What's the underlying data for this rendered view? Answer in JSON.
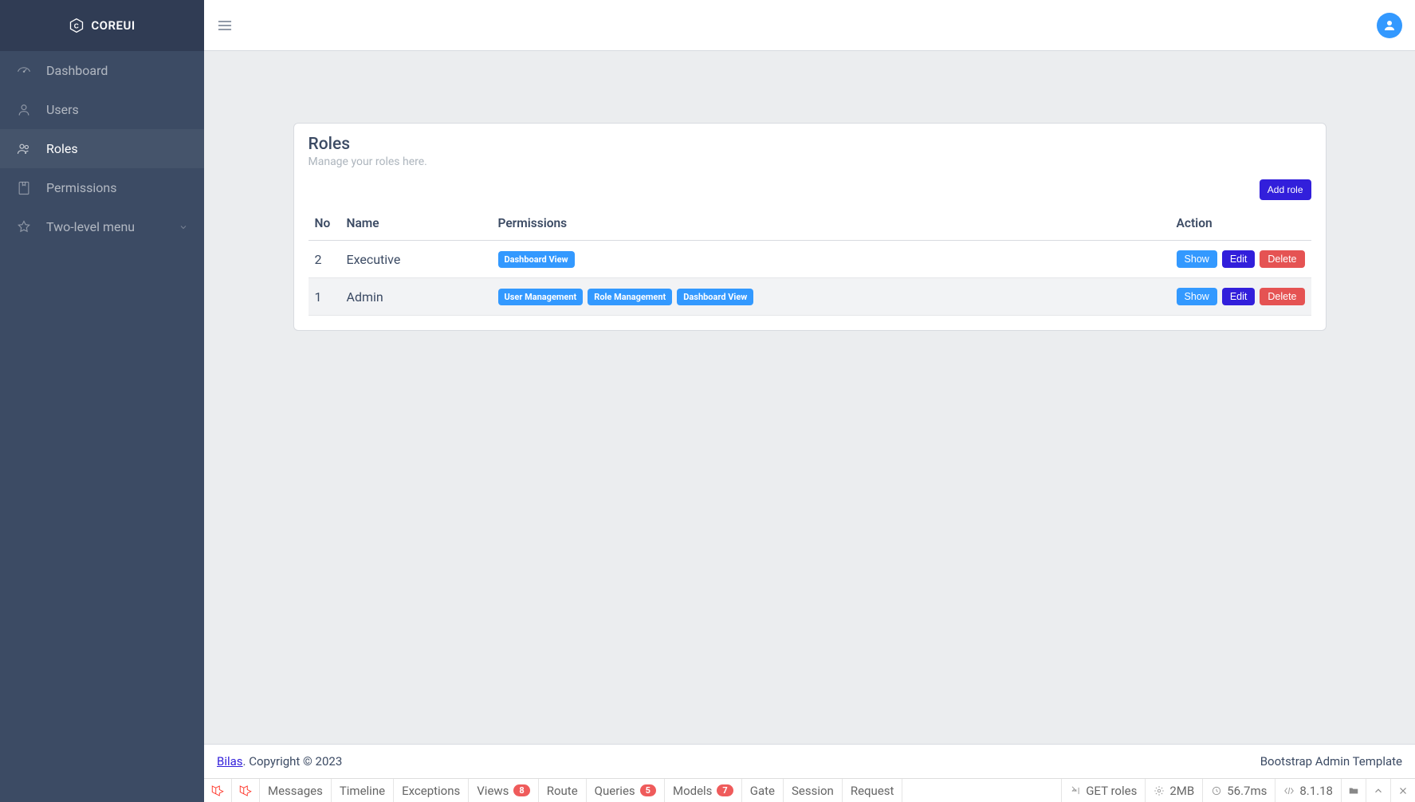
{
  "brand": "COREUI",
  "sidebar": {
    "items": [
      {
        "label": "Dashboard",
        "active": false
      },
      {
        "label": "Users",
        "active": false
      },
      {
        "label": "Roles",
        "active": true
      },
      {
        "label": "Permissions",
        "active": false
      },
      {
        "label": "Two-level menu",
        "active": false,
        "expandable": true
      }
    ]
  },
  "page": {
    "title": "Roles",
    "subtitle": "Manage your roles here.",
    "add_button": "Add role"
  },
  "table": {
    "headers": {
      "no": "No",
      "name": "Name",
      "permissions": "Permissions",
      "action": "Action"
    },
    "action_labels": {
      "show": "Show",
      "edit": "Edit",
      "delete": "Delete"
    },
    "rows": [
      {
        "no": "2",
        "name": "Executive",
        "permissions": [
          "Dashboard View"
        ]
      },
      {
        "no": "1",
        "name": "Admin",
        "permissions": [
          "User Management",
          "Role Management",
          "Dashboard View"
        ]
      }
    ]
  },
  "footer": {
    "link": "Bilas",
    "text": ". Copyright © 2023",
    "right": "Bootstrap Admin Template"
  },
  "debugbar": {
    "tabs": [
      {
        "label": "Messages"
      },
      {
        "label": "Timeline"
      },
      {
        "label": "Exceptions"
      },
      {
        "label": "Views",
        "pill": "8"
      },
      {
        "label": "Route"
      },
      {
        "label": "Queries",
        "pill": "5"
      },
      {
        "label": "Models",
        "pill": "7"
      },
      {
        "label": "Gate"
      },
      {
        "label": "Session"
      },
      {
        "label": "Request"
      }
    ],
    "right": {
      "method": "GET roles",
      "memory": "2MB",
      "time": "56.7ms",
      "version": "8.1.18"
    }
  }
}
